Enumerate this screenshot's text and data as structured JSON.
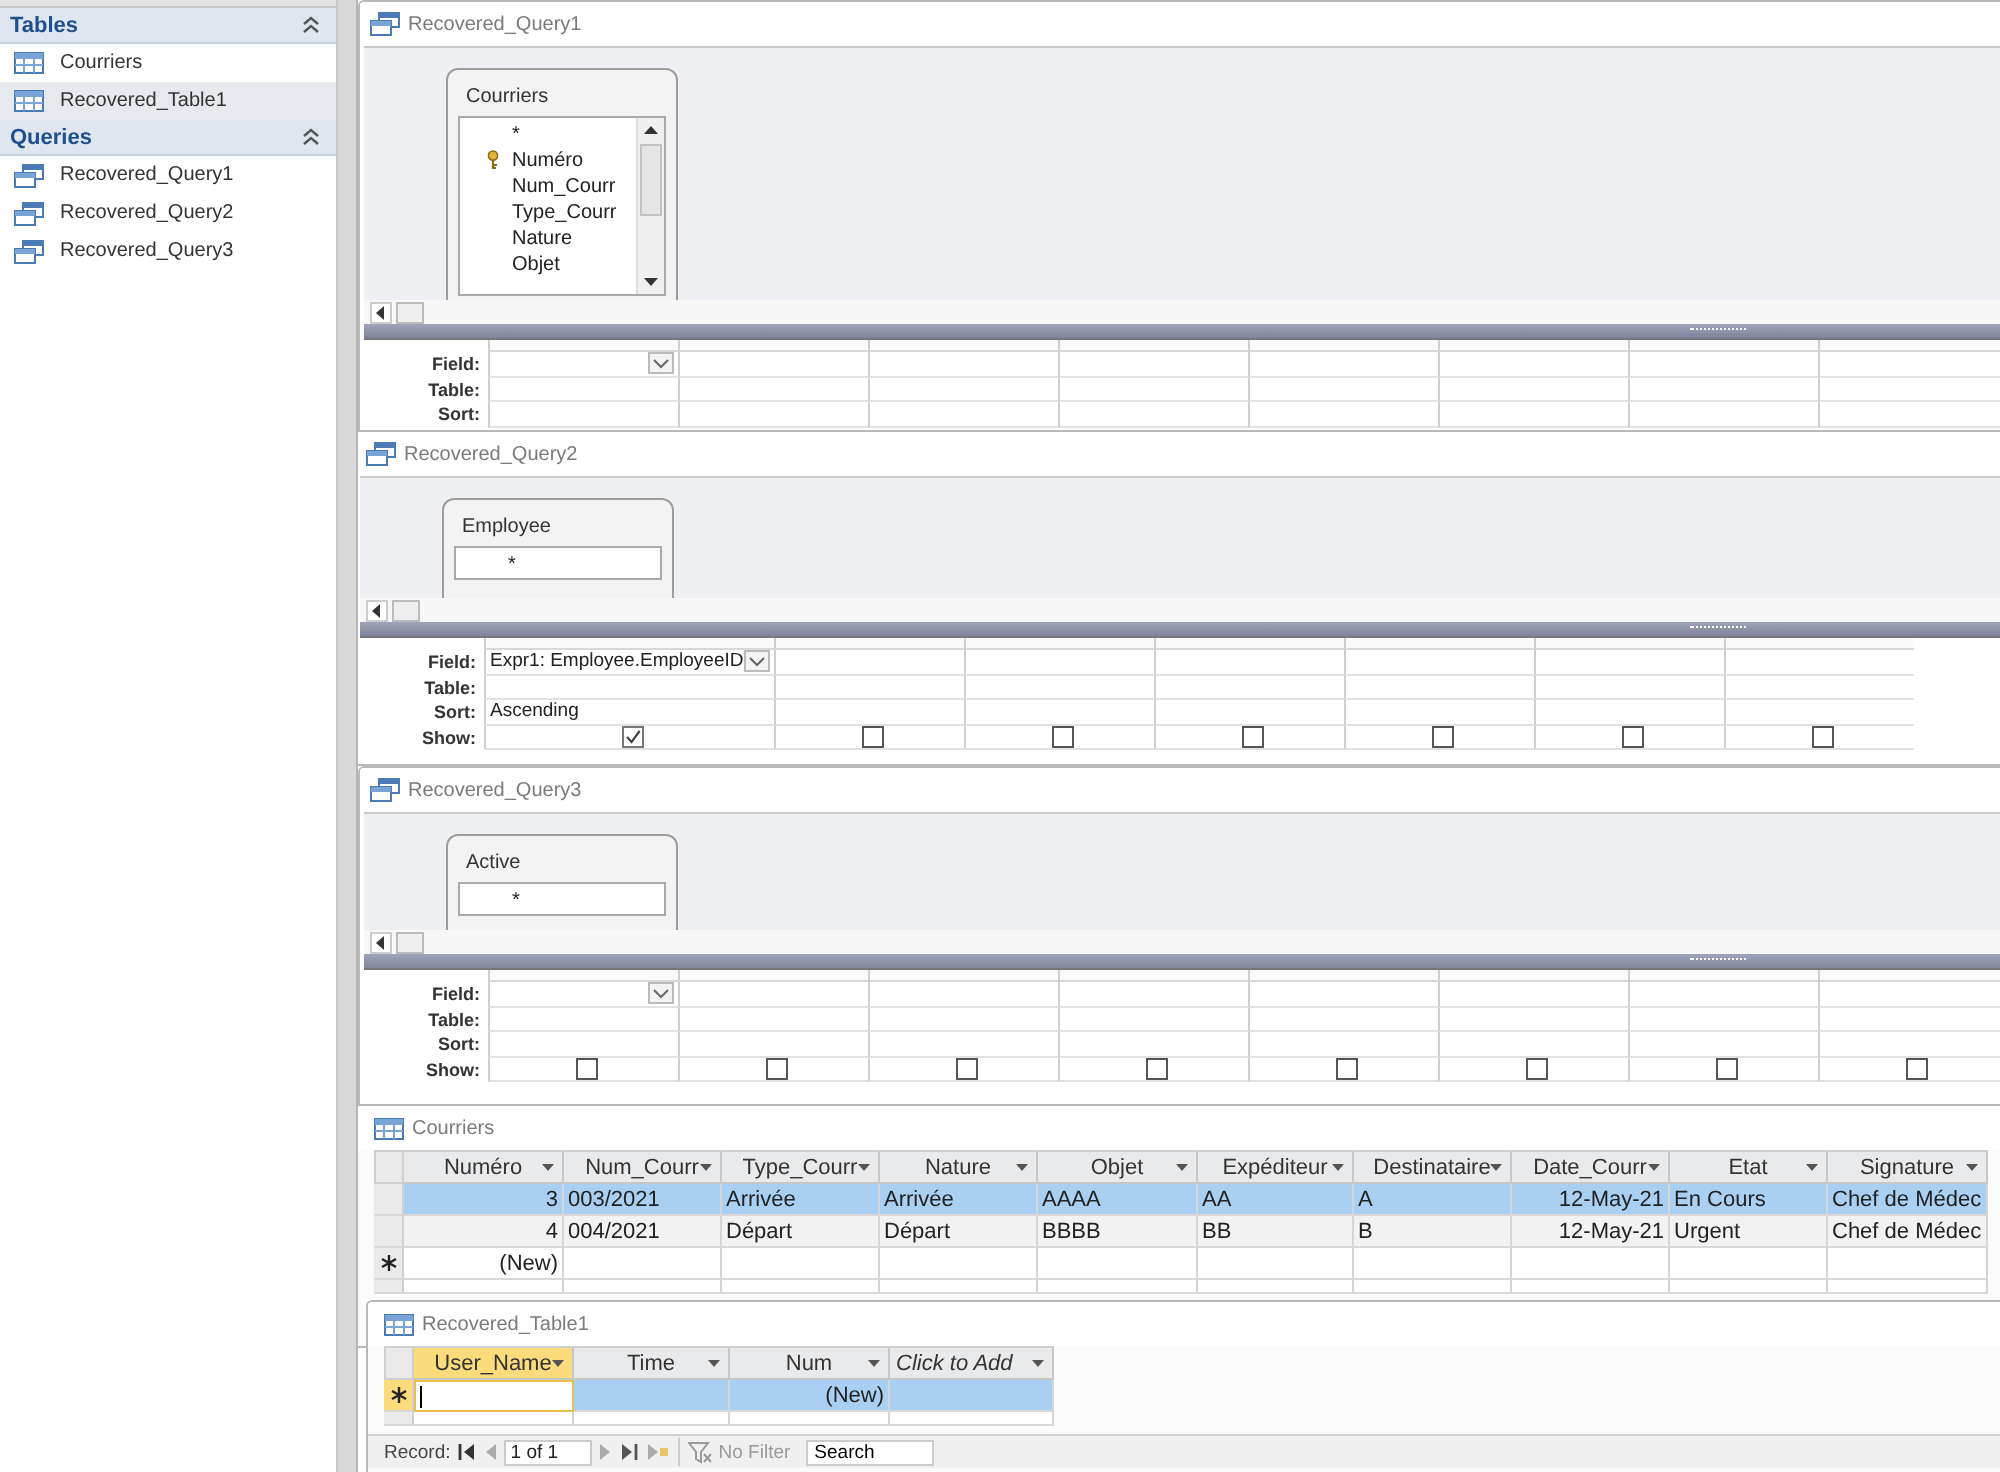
{
  "nav": {
    "groups": [
      {
        "title": "Tables",
        "expanded": true,
        "items": [
          {
            "label": "Courriers",
            "kind": "table",
            "selected": false
          },
          {
            "label": "Recovered_Table1",
            "kind": "table",
            "selected": true
          }
        ]
      },
      {
        "title": "Queries",
        "expanded": true,
        "items": [
          {
            "label": "Recovered_Query1",
            "kind": "query",
            "selected": false
          },
          {
            "label": "Recovered_Query2",
            "kind": "query",
            "selected": false
          },
          {
            "label": "Recovered_Query3",
            "kind": "query",
            "selected": false
          }
        ]
      }
    ]
  },
  "queries": [
    {
      "title": "Recovered_Query1",
      "table": {
        "name": "Courriers",
        "fields": [
          {
            "name": "*",
            "key": false
          },
          {
            "name": "Numéro",
            "key": true
          },
          {
            "name": "Num_Courr",
            "key": false
          },
          {
            "name": "Type_Courr",
            "key": false
          },
          {
            "name": "Nature",
            "key": false
          },
          {
            "name": "Objet",
            "key": false
          }
        ]
      },
      "grid": {
        "rows": [
          {
            "label": "Field:",
            "kind": "field"
          },
          {
            "label": "Table:",
            "kind": "table"
          },
          {
            "label": "Sort:",
            "kind": "sort"
          }
        ],
        "columns": [
          {
            "active": true
          },
          {
            "active": false
          },
          {
            "active": false
          },
          {
            "active": false
          },
          {
            "active": false
          },
          {
            "active": false
          },
          {
            "active": false
          },
          {
            "active": false
          }
        ]
      }
    },
    {
      "title": "Recovered_Query2",
      "table": {
        "name": "Employee",
        "fields": [
          {
            "name": "*",
            "key": false
          }
        ]
      },
      "grid": {
        "rows": [
          {
            "label": "Field:",
            "kind": "field"
          },
          {
            "label": "Table:",
            "kind": "table"
          },
          {
            "label": "Sort:",
            "kind": "sort"
          },
          {
            "label": "Show:",
            "kind": "show"
          }
        ],
        "columns": [
          {
            "active": true,
            "field": "Expr1: Employee.EmployeeID",
            "sort": "Ascending",
            "show": true
          },
          {
            "active": false,
            "show": false
          },
          {
            "active": false,
            "show": false
          },
          {
            "active": false,
            "show": false
          },
          {
            "active": false,
            "show": false
          },
          {
            "active": false,
            "show": false
          },
          {
            "active": false,
            "show": false
          }
        ]
      }
    },
    {
      "title": "Recovered_Query3",
      "table": {
        "name": "Active",
        "fields": [
          {
            "name": "*",
            "key": false
          }
        ]
      },
      "grid": {
        "rows": [
          {
            "label": "Field:",
            "kind": "field"
          },
          {
            "label": "Table:",
            "kind": "table"
          },
          {
            "label": "Sort:",
            "kind": "sort"
          },
          {
            "label": "Show:",
            "kind": "show"
          }
        ],
        "columns": [
          {
            "active": true,
            "show": false
          },
          {
            "active": false,
            "show": false
          },
          {
            "active": false,
            "show": false
          },
          {
            "active": false,
            "show": false
          },
          {
            "active": false,
            "show": false
          },
          {
            "active": false,
            "show": false
          },
          {
            "active": false,
            "show": false
          },
          {
            "active": false,
            "show": false
          }
        ]
      }
    }
  ],
  "datasheets": [
    {
      "title": "Courriers",
      "columns": [
        {
          "label": "Numéro",
          "kind": "autonumber",
          "selected": false
        },
        {
          "label": "Num_Courr",
          "kind": "text",
          "selected": false
        },
        {
          "label": "Type_Courr",
          "kind": "text",
          "selected": false
        },
        {
          "label": "Nature",
          "kind": "text",
          "selected": false
        },
        {
          "label": "Objet",
          "kind": "text",
          "selected": false
        },
        {
          "label": "Expéditeur",
          "kind": "text",
          "selected": false
        },
        {
          "label": "Destinataire",
          "kind": "text",
          "selected": false
        },
        {
          "label": "Date_Courr",
          "kind": "date",
          "selected": false
        },
        {
          "label": "Etat",
          "kind": "text",
          "selected": false
        },
        {
          "label": "Signature",
          "kind": "text",
          "selected": false
        }
      ],
      "rows": [
        {
          "selected": true,
          "cells": [
            "3",
            "003/2021",
            "Arrivée",
            "Arrivée",
            "AAAA",
            "AA",
            "A",
            "12-May-21",
            "En Cours",
            "Chef de Médec"
          ]
        },
        {
          "selected": false,
          "cells": [
            "4",
            "004/2021",
            "Départ",
            "Départ",
            "BBBB",
            "BB",
            "B",
            "12-May-21",
            "Urgent",
            "Chef de Médec"
          ]
        }
      ],
      "new_row": {
        "label": "(New)",
        "current": false
      }
    },
    {
      "title": "Recovered_Table1",
      "columns": [
        {
          "label": "User_Name",
          "kind": "text",
          "selected": true
        },
        {
          "label": "Time",
          "kind": "text",
          "selected": false
        },
        {
          "label": "Num",
          "kind": "autonumber",
          "selected": false
        },
        {
          "label": "Click to Add",
          "kind": "add",
          "selected": false
        }
      ],
      "new_row": {
        "label": "(New)",
        "current": true
      },
      "record_nav": {
        "label": "Record:",
        "position": "1 of 1",
        "filter": "No Filter",
        "search": "Search"
      }
    }
  ]
}
